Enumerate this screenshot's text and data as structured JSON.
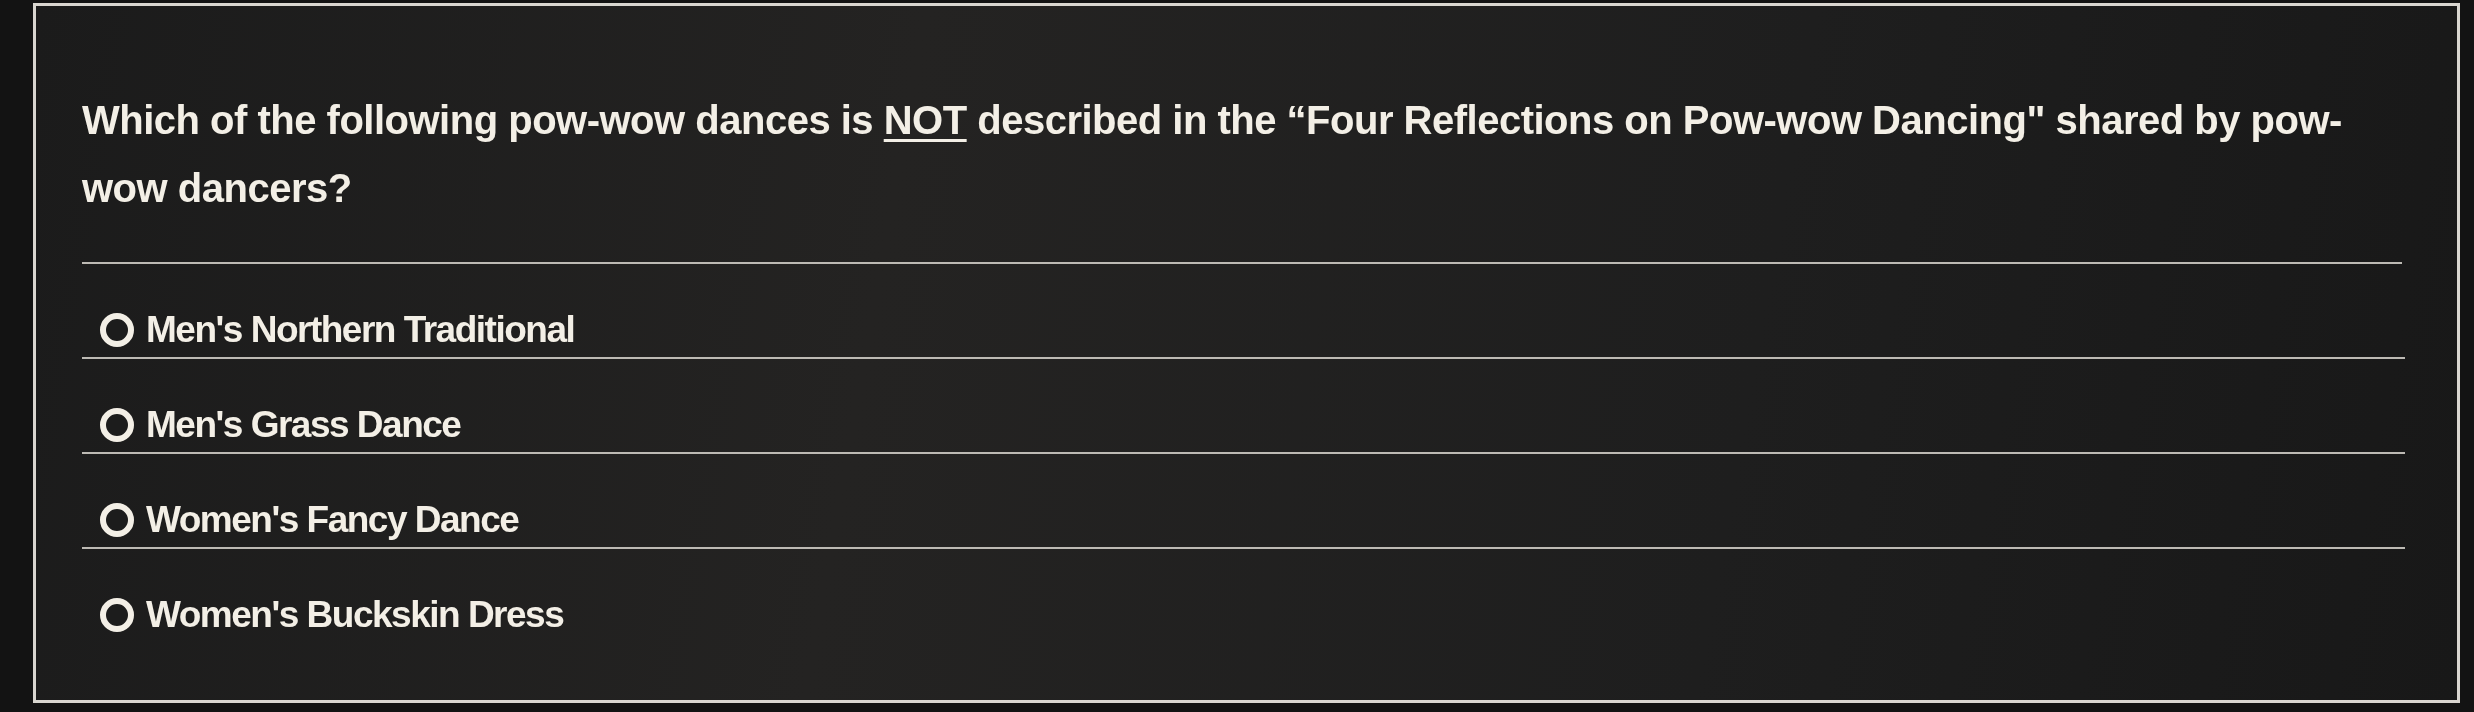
{
  "question": {
    "text": "Which of the following pow-wow dances is **NOT** described in the “Four Reflections on Pow-wow Dancing\" shared by pow-wow dancers?"
  },
  "options": [
    {
      "label": "Men's Northern Traditional",
      "selected": false
    },
    {
      "label": "Men's Grass Dance",
      "selected": false
    },
    {
      "label": "Women's Fancy Dance",
      "selected": false
    },
    {
      "label": "Women's Buckskin Dress",
      "selected": false
    }
  ]
}
